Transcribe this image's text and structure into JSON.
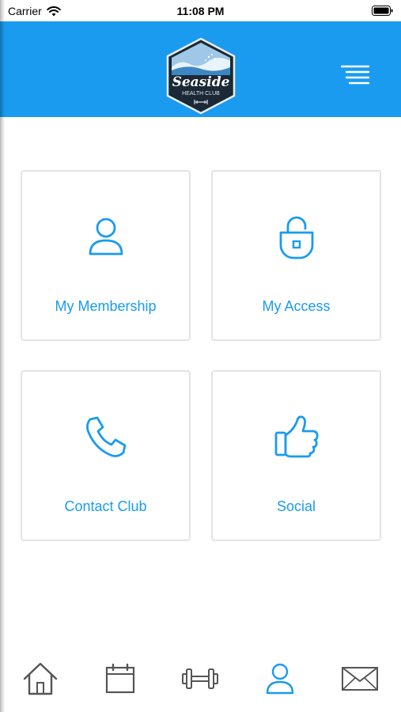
{
  "status_bar": {
    "carrier": "Carrier",
    "time": "11:08 PM"
  },
  "header": {
    "logo": {
      "name": "Seaside",
      "subtitle": "HEALTH CLUB"
    },
    "menu_icon": "menu-icon"
  },
  "tiles": [
    {
      "label": "My Membership",
      "icon": "user-icon"
    },
    {
      "label": "My Access",
      "icon": "padlock-icon"
    },
    {
      "label": "Contact Club",
      "icon": "phone-icon"
    },
    {
      "label": "Social",
      "icon": "thumbs-up-icon"
    }
  ],
  "tab_bar": {
    "items": [
      {
        "icon": "home-icon",
        "active": false
      },
      {
        "icon": "calendar-icon",
        "active": false
      },
      {
        "icon": "dumbbell-icon",
        "active": false
      },
      {
        "icon": "user-icon",
        "active": true
      },
      {
        "icon": "mail-icon",
        "active": false
      }
    ]
  },
  "colors": {
    "accent": "#1a9bf0",
    "tile_border": "#e4e4e4",
    "tab_inactive": "#555555",
    "logo_dark": "#1b2836"
  }
}
